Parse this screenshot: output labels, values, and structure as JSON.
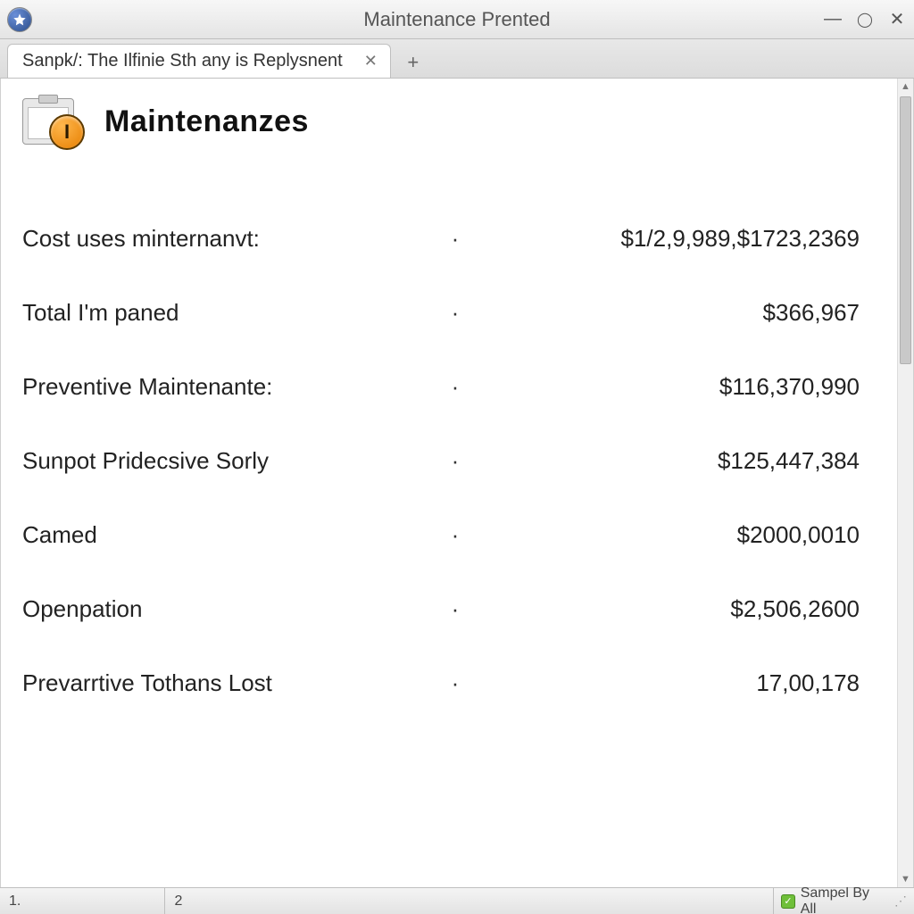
{
  "window": {
    "title": "Maintenance Prented"
  },
  "tabs": {
    "active_label": "Sanpk/: The Ilfinie Sth any is Replysnent"
  },
  "page": {
    "heading": "Maintenanzes",
    "icon_badge_glyph": "I"
  },
  "rows": [
    {
      "label": "Cost uses minternanvt:",
      "value": "$1/2,9,989,$1723,2369"
    },
    {
      "label": "Total I'm paned",
      "value": "$366,967"
    },
    {
      "label": "Preventive Maintenante:",
      "value": "$116,370,990"
    },
    {
      "label": "Sunpot Pridecsive Sorly",
      "value": "$125,447,384"
    },
    {
      "label": "Camed",
      "value": "$2000,0010"
    },
    {
      "label": "Openpation",
      "value": "$2,506,2600"
    },
    {
      "label": "Prevarrtive Tothans Lost",
      "value": "17,00,178"
    }
  ],
  "statusbar": {
    "cell1": "1.",
    "cell2": "2",
    "right_label": "Sampel By All"
  },
  "separator": "·"
}
